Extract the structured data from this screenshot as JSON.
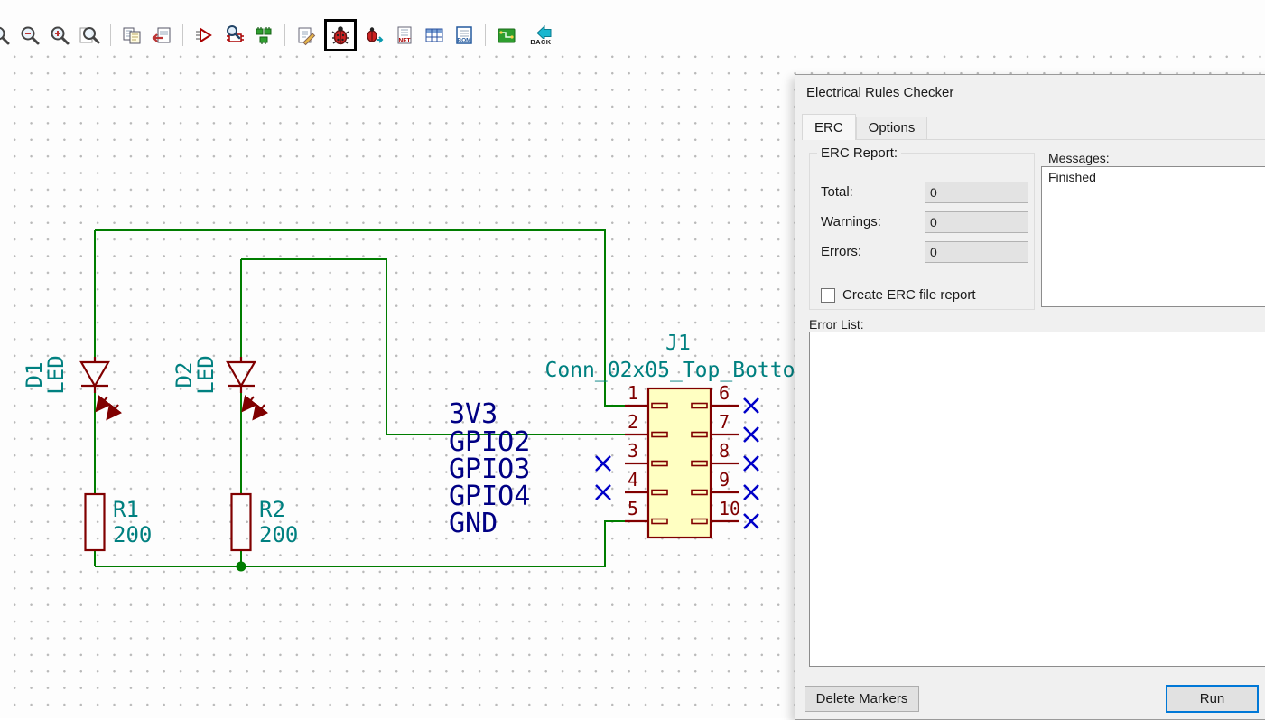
{
  "toolbar": {
    "icons": [
      {
        "name": "zoom-redraw"
      },
      {
        "name": "zoom-out"
      },
      {
        "name": "zoom-in"
      },
      {
        "name": "zoom-fit"
      },
      {
        "name": "hierarchy-navigator"
      },
      {
        "name": "leave-sheet"
      },
      {
        "name": "annotate"
      },
      {
        "name": "symbol-library-browser"
      },
      {
        "name": "symbol-library-editor"
      },
      {
        "name": "edit-symbol-fields"
      },
      {
        "name": "erc"
      },
      {
        "name": "erc-details"
      },
      {
        "name": "netlist"
      },
      {
        "name": "symbol-fields-table"
      },
      {
        "name": "bom"
      },
      {
        "name": "pcbnew"
      },
      {
        "name": "back-annotate"
      }
    ],
    "net_label": "NET",
    "bom_label": "BOM",
    "back_label": "BACK"
  },
  "schematic": {
    "components": {
      "d1": {
        "ref": "D1",
        "value": "LED"
      },
      "d2": {
        "ref": "D2",
        "value": "LED"
      },
      "r1": {
        "ref": "R1",
        "value": "200"
      },
      "r2": {
        "ref": "R2",
        "value": "200"
      },
      "j1": {
        "ref": "J1",
        "value": "Conn_02x05_Top_Botto"
      }
    },
    "net_labels": [
      "3V3",
      "GPIO2",
      "GPIO3",
      "GPIO4",
      "GND"
    ],
    "left_pins": [
      "1",
      "2",
      "3",
      "4",
      "5"
    ],
    "right_pins": [
      "6",
      "7",
      "8",
      "9",
      "10"
    ],
    "colors": {
      "wire": "#007d00",
      "component_outline": "#800000",
      "component_fill": "#FFFFC2",
      "fields": "#008080",
      "net_label": "#000084",
      "no_connect": "#0000c8"
    }
  },
  "dialog": {
    "title": "Electrical Rules Checker",
    "tabs": [
      {
        "label": "ERC",
        "active": true
      },
      {
        "label": "Options",
        "active": false
      }
    ],
    "erc_report": {
      "group_label": "ERC Report:",
      "rows": [
        {
          "label": "Total:",
          "value": "0"
        },
        {
          "label": "Warnings:",
          "value": "0"
        },
        {
          "label": "Errors:",
          "value": "0"
        }
      ],
      "checkbox_label": "Create ERC file report",
      "checkbox_checked": false
    },
    "messages": {
      "label": "Messages:",
      "content": "Finished"
    },
    "error_list": {
      "label": "Error List:"
    },
    "buttons": {
      "delete_markers": "Delete Markers",
      "run": "Run"
    },
    "accent_color": "#0078d7"
  }
}
